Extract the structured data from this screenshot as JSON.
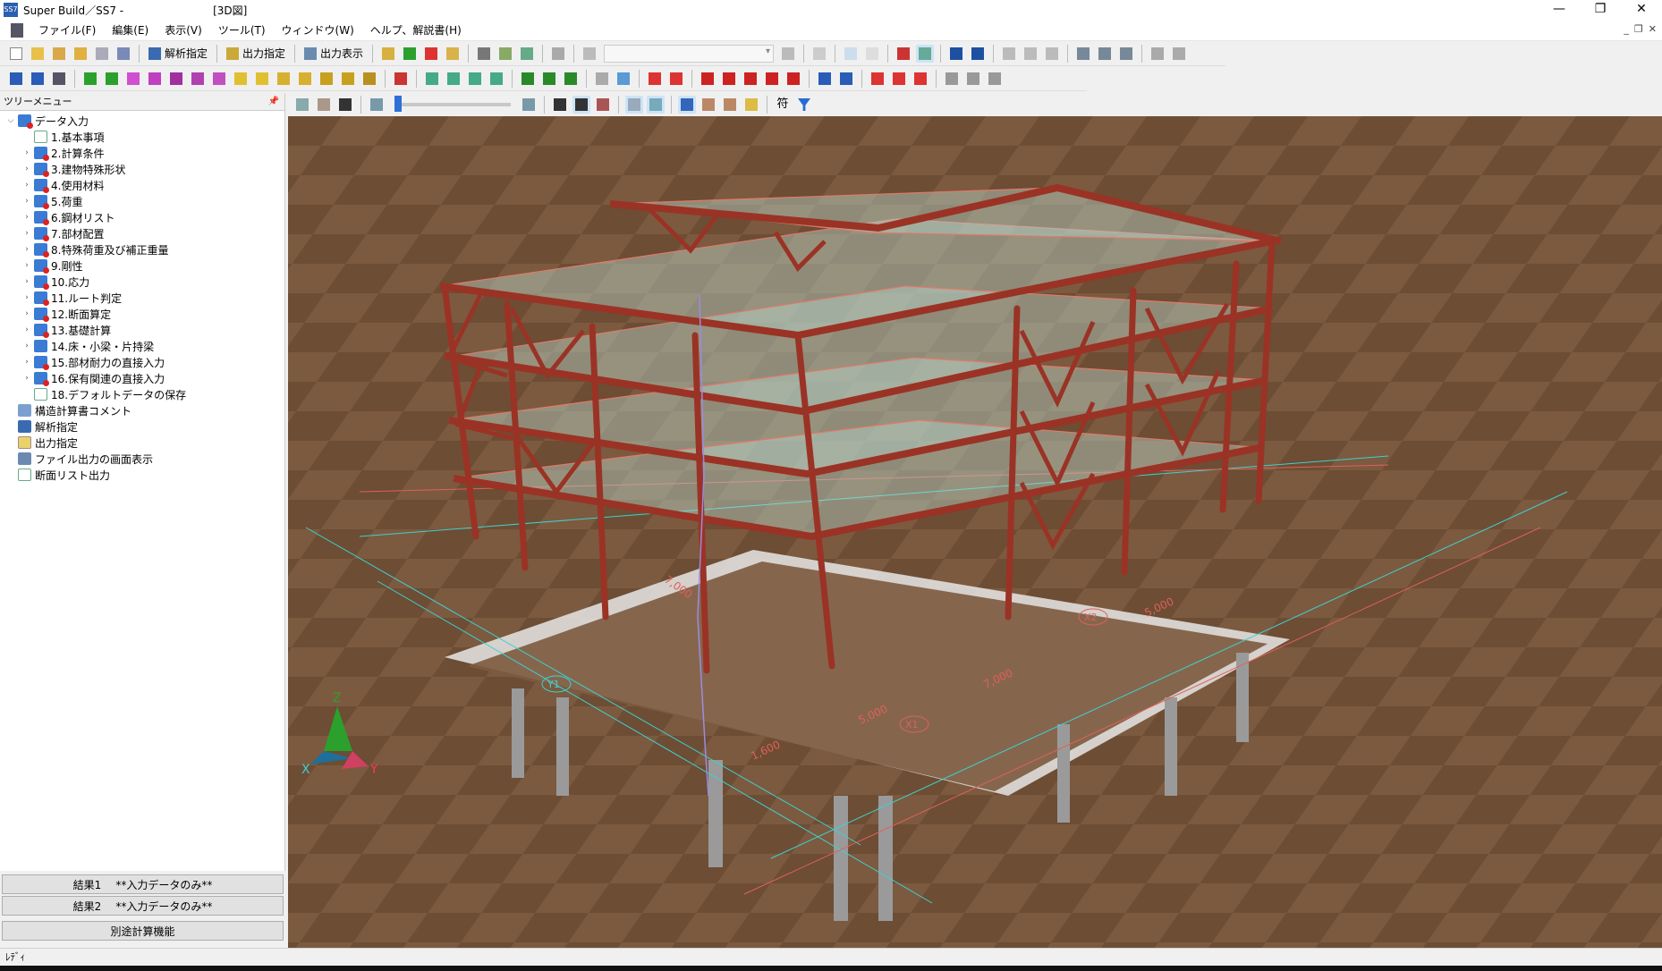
{
  "window": {
    "title": "Super Build／SS7 -",
    "document": "[3D図]",
    "app_icon_text": "SS7"
  },
  "menu": [
    "ファイル(F)",
    "編集(E)",
    "表示(V)",
    "ツール(T)",
    "ウィンドウ(W)",
    "ヘルプ、解説書(H)"
  ],
  "toolbar": {
    "analysis_label": "解析指定",
    "output_spec_label": "出力指定",
    "output_view_label": "出力表示"
  },
  "view_toolbar": {
    "text_button": "符"
  },
  "tree": {
    "header": "ツリーメニュー",
    "root": "データ入力",
    "items": [
      "1.基本事項",
      "2.計算条件",
      "3.建物特殊形状",
      "4.使用材料",
      "5.荷重",
      "6.鋼材リスト",
      "7.部材配置",
      "8.特殊荷重及び補正重量",
      "9.剛性",
      "10.応力",
      "11.ルート判定",
      "12.断面算定",
      "13.基礎計算",
      "14.床・小梁・片持梁",
      "15.部材耐力の直接入力",
      "16.保有関連の直接入力",
      "18.デフォルトデータの保存"
    ],
    "others": [
      "構造計算書コメント",
      "解析指定",
      "出力指定",
      "ファイル出力の画面表示",
      "断面リスト出力"
    ]
  },
  "results": [
    {
      "label": "結果1",
      "value": "**入力データのみ**"
    },
    {
      "label": "結果2",
      "value": "**入力データのみ**"
    }
  ],
  "extra_button": "別途計算機能",
  "axes": {
    "z": "Z",
    "x": "X",
    "y": "Y"
  },
  "dimensions": [
    "5,000",
    "7,000",
    "5,000",
    "1,600",
    "7,000"
  ],
  "grid_marks": [
    "X1",
    "X2",
    "Y1"
  ],
  "status": "ﾚﾃﾞｨ",
  "colors": {
    "steel": "#9a3325",
    "ground": "#7c5a3f",
    "slab": "#b7d8cc",
    "grid_line": "#3fd0d0"
  }
}
